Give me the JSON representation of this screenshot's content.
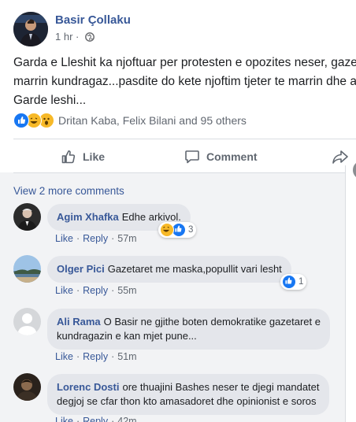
{
  "post": {
    "author": "Basir Çollaku",
    "time": "1 hr",
    "separator": "·",
    "text_lines": [
      "Garda e Lleshit ka njoftuar per protesten e opozites neser, gazetaret te",
      "marrin kundragaz...pasdite do kete njoftim tjeter te marrin dhe arkivol.",
      "Garde leshi..."
    ],
    "reactions_text": "Dritan Kaba, Felix Bilani and 95 others",
    "reaction_icons": [
      "like-icon",
      "haha-icon",
      "wow-icon"
    ]
  },
  "actions": {
    "like": "Like",
    "comment": "Comment"
  },
  "comments_section": {
    "view_more": "View 2 more comments",
    "like_label": "Like",
    "reply_label": "Reply",
    "dot": "·",
    "comments": [
      {
        "name": "Agim Xhafka",
        "text": "Edhe arkivol.",
        "time": "57m",
        "reaction_count": "3",
        "reaction_icons": [
          "haha-icon",
          "like-icon"
        ]
      },
      {
        "name": "Olger Pici",
        "text": "Gazetaret me maska,popullit vari lesht",
        "time": "55m",
        "reaction_count": "1",
        "reaction_icons": [
          "like-icon"
        ]
      },
      {
        "name": "Ali Rama",
        "text_lines": [
          "O Basir ne gjithe boten demokratike gazetaret e",
          "kundragazin e kan mjet pune..."
        ],
        "time": "51m"
      },
      {
        "name": "Lorenc Dosti",
        "text_lines": [
          "ore thuajini Bashes neser te djegi mandatet",
          "degjoj se cfar thon kto amasadoret dhe opinionist e soros"
        ],
        "time": "42m"
      }
    ]
  },
  "colors": {
    "link_blue": "#385898",
    "like_blue": "#1877f2",
    "bubble_gray": "#e4e6eb",
    "comments_background": "#f2f3f5"
  }
}
